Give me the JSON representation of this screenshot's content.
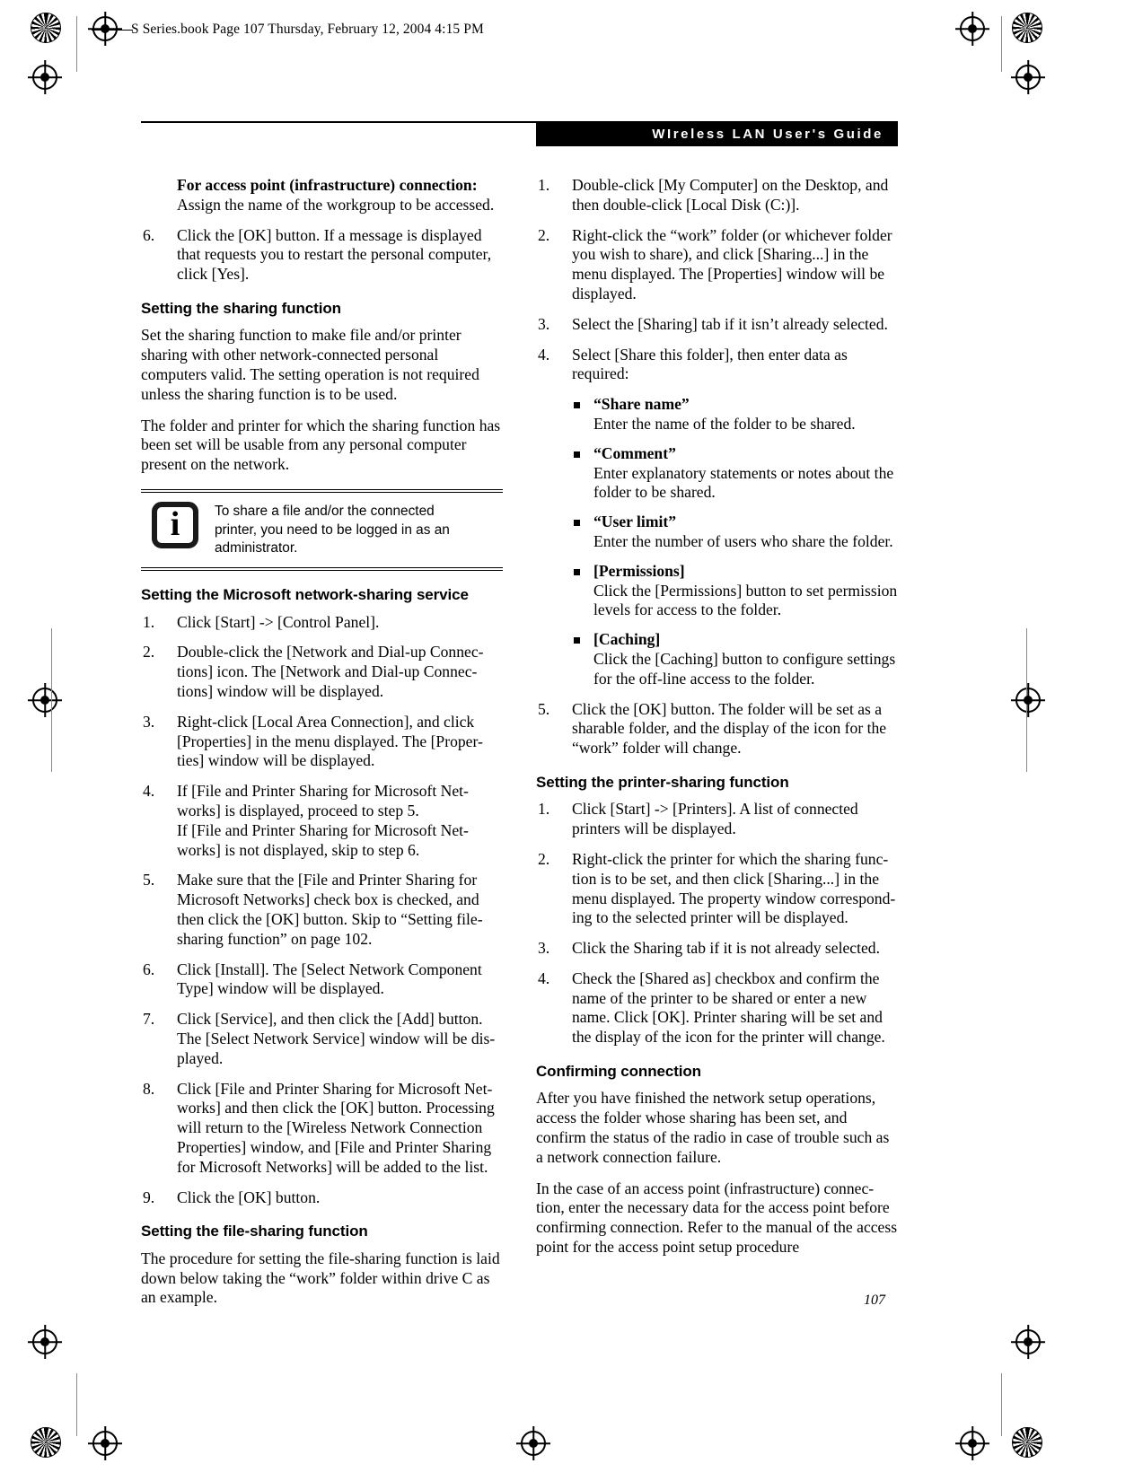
{
  "header": {
    "file_line": "S Series.book  Page 107  Thursday, February 12, 2004  4:15 PM",
    "guide_title": "WIreless LAN User's Guide"
  },
  "page_number": "107",
  "note": {
    "icon": "information-icon",
    "glyph": "i",
    "lines": [
      "To share a file and/or the connected",
      "printer, you need to be logged in as an",
      "administrator."
    ]
  },
  "left_column": {
    "intro_block": {
      "lead": "For access point (infrastructure) connection:",
      "lines": [
        "Assign the name of the workgroup to be accessed."
      ]
    },
    "step6": {
      "num": "6.",
      "lines": [
        "Click the [OK] button. If a message is displayed",
        "that requests you to restart the personal computer,",
        "click [Yes]."
      ]
    },
    "heading_sharing": "Setting the sharing function",
    "para_sharing_1": [
      "Set the sharing function to make file and/or printer",
      "sharing with other network-connected personal",
      "computers valid. The setting operation is not required",
      "unless the sharing function is to be used."
    ],
    "para_sharing_2": [
      "The folder and printer for which the sharing function",
      "has been set will be usable from any personal computer",
      "present on the network."
    ],
    "heading_ms_service": "Setting the Microsoft network-sharing service",
    "ms_steps": [
      {
        "num": "1.",
        "lines": [
          "Click [Start] -> [Control Panel]."
        ]
      },
      {
        "num": "2.",
        "lines": [
          "Double-click the [Network and Dial-up Connec-",
          "tions] icon. The [Network and Dial-up Connec-",
          "tions] window will be displayed."
        ]
      },
      {
        "num": "3.",
        "lines": [
          "Right-click [Local Area Connection], and click",
          "[Properties] in the menu displayed. The [Proper-",
          "ties] window will be displayed."
        ]
      },
      {
        "num": "4.",
        "lines": [
          "If [File and Printer Sharing for Microsoft Net-",
          "works] is displayed, proceed to step 5.",
          "If [File and Printer Sharing for Microsoft Net-",
          "works] is not displayed, skip to step 6."
        ]
      },
      {
        "num": "5.",
        "lines": [
          "Make sure that the [File and Printer Sharing for",
          "Microsoft Networks] check box is checked, and",
          "then click the [OK] button. Skip to “Setting file-",
          "sharing function” on page 102."
        ]
      },
      {
        "num": "6.",
        "lines": [
          "Click [Install]. The [Select Network Component",
          "Type] window will be displayed."
        ]
      },
      {
        "num": "7.",
        "lines": [
          "Click [Service], and then click the [Add] button.",
          "The [Select Network Service] window will be dis-",
          "played."
        ]
      },
      {
        "num": "8.",
        "lines": [
          "Click [File and Printer Sharing for Microsoft Net-",
          "works] and then click the [OK] button. Processing",
          "will return to the [Wireless Network Connection",
          "Properties] window, and [File and Printer Sharing",
          "for Microsoft Networks] will be added to the list."
        ]
      },
      {
        "num": "9.",
        "lines": [
          "Click the [OK] button."
        ]
      }
    ],
    "heading_file_sharing": "Setting the file-sharing function",
    "para_file_sharing": [
      "The procedure for setting the file-sharing function is laid",
      "down below taking the “work” folder within drive C as",
      "an example."
    ]
  },
  "right_column": {
    "file_steps": [
      {
        "num": "1.",
        "lines": [
          "Double-click [My Computer] on the Desktop, and",
          "then double-click [Local Disk (C:)]."
        ]
      },
      {
        "num": "2.",
        "lines": [
          "Right-click the “work” folder (or whichever folder",
          "you wish to share), and click [Sharing...] in the",
          "menu displayed. The [Properties] window will be",
          "displayed."
        ]
      },
      {
        "num": "3.",
        "lines": [
          "Select the [Sharing] tab if it isn’t already selected."
        ]
      },
      {
        "num": "4.",
        "lines": [
          "Select [Share this folder], then enter data as",
          "required:"
        ]
      }
    ],
    "bullets": [
      {
        "label": "“Share name”",
        "lines": [
          "Enter the name of the folder to be shared."
        ]
      },
      {
        "label": "“Comment”",
        "lines": [
          "Enter explanatory statements or notes about the",
          "folder to be shared."
        ]
      },
      {
        "label": "“User limit”",
        "lines": [
          "Enter the number of users who share the folder."
        ]
      },
      {
        "label": "[Permissions]",
        "lines": [
          "Click the [Permissions] button to set permission",
          "levels for access to the folder."
        ]
      },
      {
        "label": "[Caching]",
        "lines": [
          "Click the [Caching] button to configure settings",
          "for the off-line access to the folder."
        ]
      }
    ],
    "step5": {
      "num": "5.",
      "lines": [
        "Click the [OK] button. The folder will be set as a",
        "sharable folder, and the display of the icon for the",
        "“work” folder will change."
      ]
    },
    "heading_printer_sharing": "Setting the printer-sharing function",
    "printer_steps": [
      {
        "num": "1.",
        "lines": [
          "Click [Start] -> [Printers]. A list of connected",
          "printers will be displayed."
        ]
      },
      {
        "num": "2.",
        "lines": [
          "Right-click the printer for which the sharing func-",
          "tion is to be set, and then click [Sharing...] in the",
          "menu displayed. The property window correspond-",
          "ing to the selected printer will be displayed."
        ]
      },
      {
        "num": "3.",
        "lines": [
          "Click the Sharing tab if it is not already selected."
        ]
      },
      {
        "num": "4.",
        "lines": [
          "Check the [Shared as] checkbox and confirm the",
          "name of the printer to be shared or enter a new",
          "name. Click [OK]. Printer sharing will be set and",
          "the display of the icon for the printer will change."
        ]
      }
    ],
    "heading_confirming": "Confirming connection",
    "para_confirm_1": [
      "After you have finished the network setup operations,",
      "access the folder whose sharing has been set, and",
      "confirm the status of the radio in case of trouble such as",
      "a network connection failure."
    ],
    "para_confirm_2": [
      "In the case of an access point (infrastructure) connec-",
      "tion, enter the necessary data for the access point before",
      "confirming connection. Refer to the manual of the access",
      "point for the access point setup procedure"
    ]
  }
}
